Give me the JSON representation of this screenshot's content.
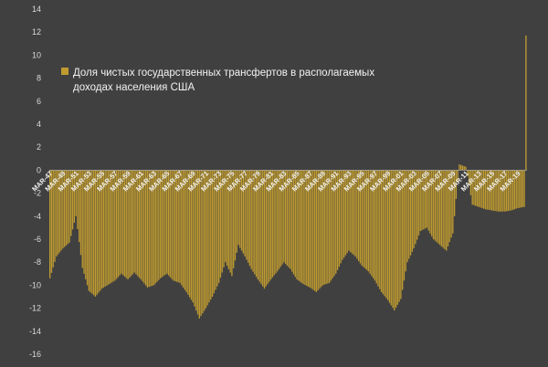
{
  "chart_data": {
    "type": "bar",
    "legend": {
      "label_line1": "Доля чистых государственных трансфертов в располагаемых",
      "label_line2": "доходах населения США",
      "color": "#bf9b30"
    },
    "bar_color": "#bf9b30",
    "background": "#404040",
    "ylim": [
      -16,
      14
    ],
    "yticks": [
      14,
      12,
      10,
      8,
      6,
      4,
      2,
      0,
      -2,
      -4,
      -6,
      -8,
      -10,
      -12,
      -14,
      -16
    ],
    "grid": false,
    "x_tick_labels": [
      "MAR-47",
      "MAR-49",
      "MAR-51",
      "MAR-53",
      "MAR-55",
      "MAR-57",
      "MAR-59",
      "MAR-61",
      "MAR-63",
      "MAR-65",
      "MAR-67",
      "MAR-69",
      "MAR-71",
      "MAR-73",
      "MAR-75",
      "MAR-77",
      "MAR-79",
      "MAR-81",
      "MAR-83",
      "MAR-85",
      "MAR-87",
      "MAR-89",
      "MAR-91",
      "MAR-93",
      "MAR-95",
      "MAR-97",
      "MAR-99",
      "MAR-01",
      "MAR-03",
      "MAR-05",
      "MAR-07",
      "MAR-09",
      "MAR-11",
      "MAR-13",
      "MAR-15",
      "MAR-17",
      "MAR-19"
    ],
    "series_profile": {
      "x_start": "1947-Q1",
      "x_end": "2020-Q2",
      "frequency": "quarterly",
      "anchor_values": [
        [
          "1947",
          -9.4
        ],
        [
          "1948",
          -7.5
        ],
        [
          "1949",
          -6.8
        ],
        [
          "1950",
          -6.3
        ],
        [
          "1951",
          -4.0
        ],
        [
          "1952",
          -8.5
        ],
        [
          "1953",
          -10.5
        ],
        [
          "1954",
          -11.0
        ],
        [
          "1955",
          -10.3
        ],
        [
          "1957",
          -9.6
        ],
        [
          "1958",
          -9.0
        ],
        [
          "1959",
          -9.5
        ],
        [
          "1960",
          -8.9
        ],
        [
          "1961",
          -9.5
        ],
        [
          "1962",
          -10.2
        ],
        [
          "1963",
          -10.0
        ],
        [
          "1964",
          -9.4
        ],
        [
          "1965",
          -9.0
        ],
        [
          "1966",
          -9.6
        ],
        [
          "1967",
          -9.8
        ],
        [
          "1968",
          -10.6
        ],
        [
          "1969",
          -11.5
        ],
        [
          "1970",
          -12.9
        ],
        [
          "1971",
          -12.0
        ],
        [
          "1972",
          -11.0
        ],
        [
          "1973",
          -9.8
        ],
        [
          "1974",
          -8.0
        ],
        [
          "1975",
          -9.2
        ],
        [
          "1976",
          -6.5
        ],
        [
          "1977",
          -7.5
        ],
        [
          "1978",
          -8.6
        ],
        [
          "1979",
          -9.5
        ],
        [
          "1980",
          -10.3
        ],
        [
          "1981",
          -9.5
        ],
        [
          "1982",
          -8.8
        ],
        [
          "1983",
          -8.0
        ],
        [
          "1984",
          -8.6
        ],
        [
          "1985",
          -9.5
        ],
        [
          "1986",
          -9.9
        ],
        [
          "1987",
          -10.2
        ],
        [
          "1988",
          -10.6
        ],
        [
          "1989",
          -10.0
        ],
        [
          "1990",
          -9.8
        ],
        [
          "1991",
          -9.0
        ],
        [
          "1992",
          -7.8
        ],
        [
          "1993",
          -7.0
        ],
        [
          "1994",
          -7.5
        ],
        [
          "1995",
          -8.3
        ],
        [
          "1996",
          -8.8
        ],
        [
          "1997",
          -9.6
        ],
        [
          "1998",
          -10.6
        ],
        [
          "1999",
          -11.3
        ],
        [
          "2000",
          -12.2
        ],
        [
          "2001",
          -11.2
        ],
        [
          "2002",
          -8.0
        ],
        [
          "2003",
          -6.8
        ],
        [
          "2004",
          -5.3
        ],
        [
          "2005",
          -5.0
        ],
        [
          "2006",
          -6.0
        ],
        [
          "2007",
          -6.5
        ],
        [
          "2008",
          -7.0
        ],
        [
          "2009",
          -5.5
        ],
        [
          "2010",
          0.5
        ],
        [
          "2011",
          0.3
        ],
        [
          "2012",
          -3.0
        ],
        [
          "2013",
          -3.2
        ],
        [
          "2014",
          -3.4
        ],
        [
          "2015",
          -3.5
        ],
        [
          "2016",
          -3.6
        ],
        [
          "2017",
          -3.6
        ],
        [
          "2018",
          -3.5
        ],
        [
          "2019",
          -3.3
        ],
        [
          "2020-Q1",
          -3.2
        ],
        [
          "2020-Q2",
          11.7
        ]
      ]
    }
  }
}
